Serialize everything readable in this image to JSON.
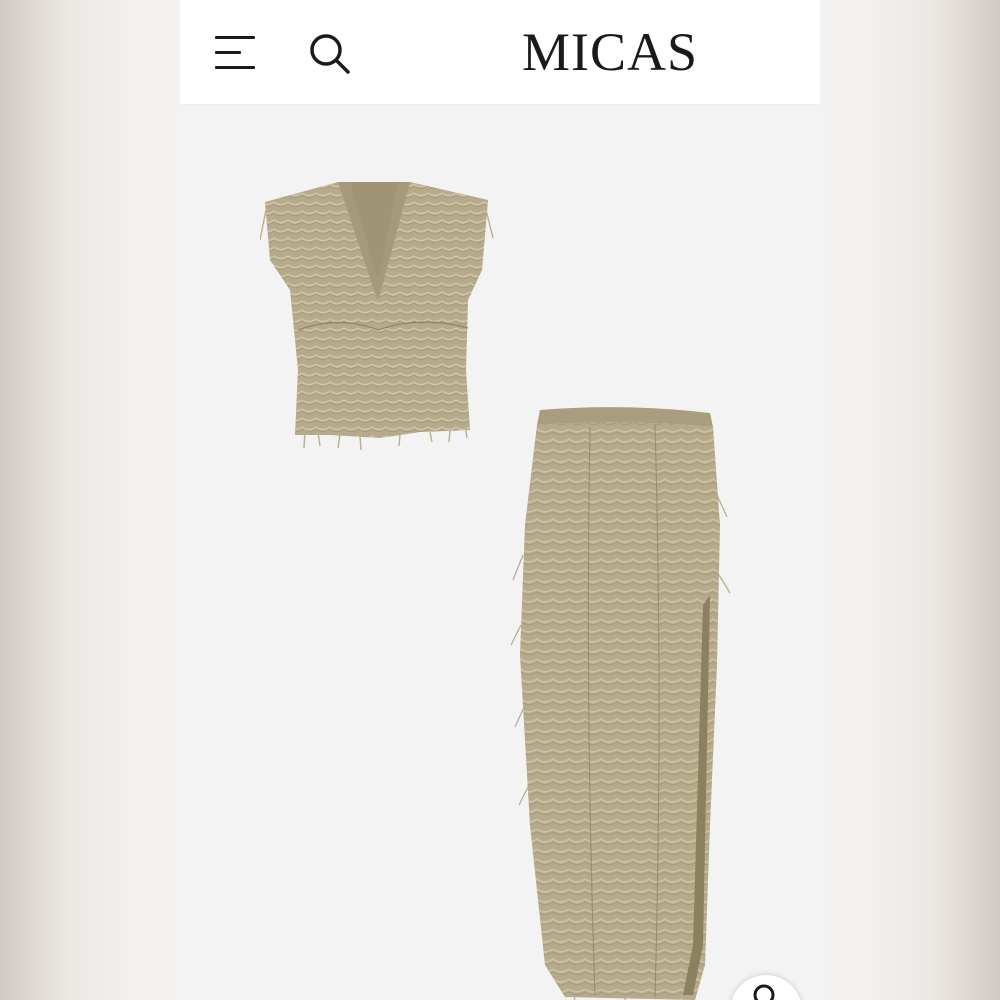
{
  "header": {
    "brand": "MICAS",
    "menu_icon": "hamburger-menu-icon",
    "search_icon": "search-icon"
  },
  "gallery": {
    "items": [
      "fringe-crop-top",
      "fringe-maxi-skirt"
    ],
    "garment_color": "#b5aa8c",
    "zoom_icon": "zoom-icon"
  },
  "colors": {
    "header_bg": "#ffffff",
    "gallery_bg": "#f3f3f3",
    "text": "#1a1a1a"
  }
}
